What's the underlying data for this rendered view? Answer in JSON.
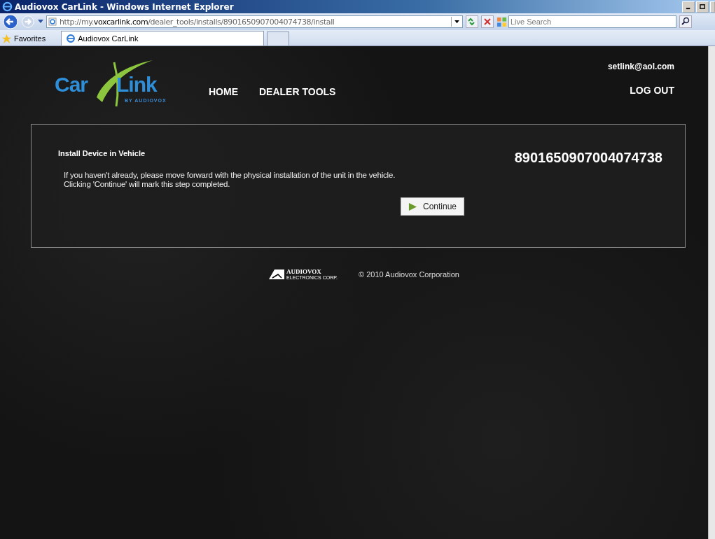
{
  "window": {
    "title": "Audiovox CarLink - Windows Internet Explorer"
  },
  "address_bar": {
    "url_prefix": "http://my.",
    "url_domain": "voxcarlink.com",
    "url_path": "/dealer_tools/installs/8901650907004074738/install"
  },
  "search": {
    "placeholder": "Live Search"
  },
  "favorites": {
    "label": "Favorites"
  },
  "tabs": [
    {
      "label": "Audiovox CarLink",
      "selected": true
    }
  ],
  "logo": {
    "part_1": "Car",
    "part_2": "Link",
    "tagline": "BY AUDIOVOX"
  },
  "nav": [
    {
      "label": "HOME"
    },
    {
      "label": "DEALER TOOLS"
    }
  ],
  "account": {
    "email": "setlink@aol.com",
    "logout": "LOG OUT"
  },
  "panel": {
    "title": "Install Device in Vehicle",
    "device_id": "8901650907004074738",
    "lines": [
      "If you haven't already, please move forward with the physical installation of the unit in the vehicle.",
      "Clicking 'Continue' will mark this step completed."
    ],
    "button": "Continue"
  },
  "footer": {
    "brand": "AUDIOVOX",
    "brand_sub": "ELECTRONICS CORP.",
    "copyright": "© 2010 Audiovox Corporation"
  }
}
